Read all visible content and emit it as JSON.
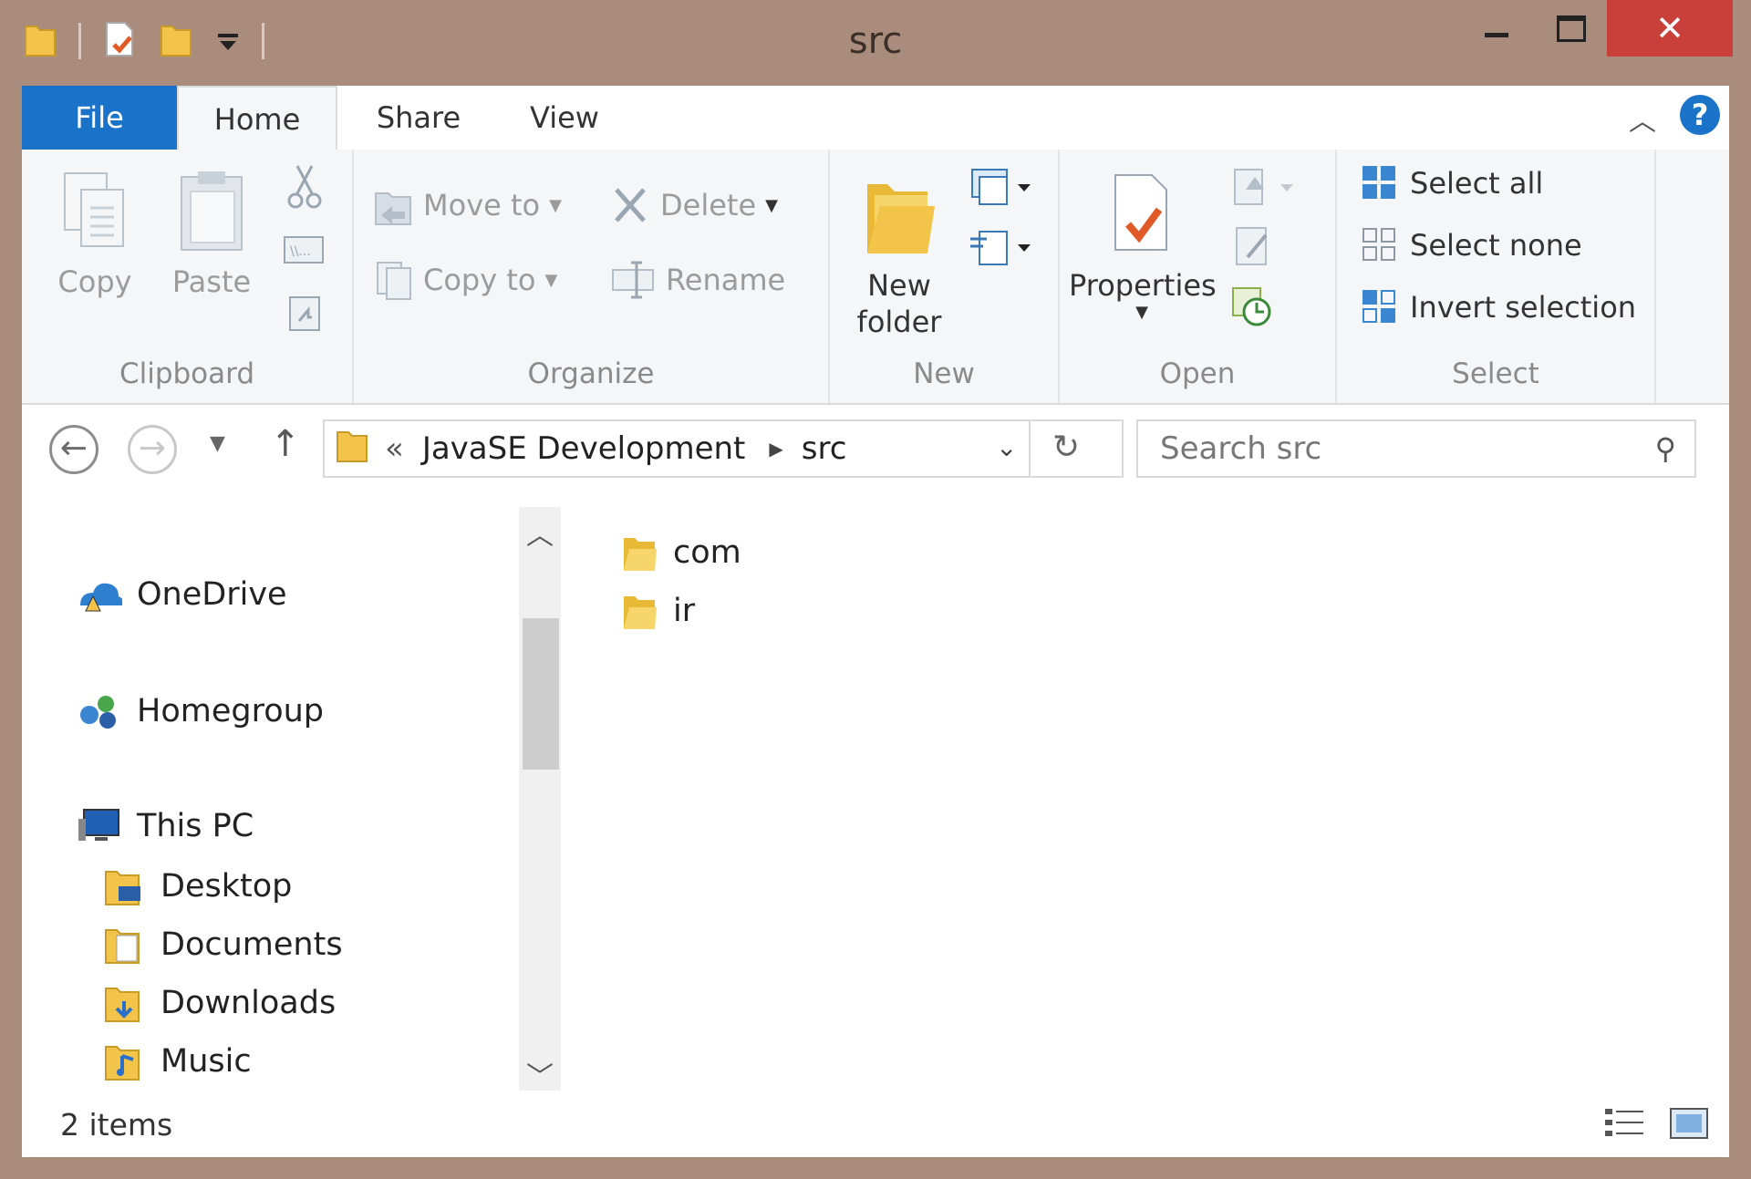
{
  "window": {
    "title": "src"
  },
  "titlebar": {
    "minimize_label": "",
    "maximize_label": "",
    "close_label": "✕"
  },
  "tabs": [
    {
      "label": "File"
    },
    {
      "label": "Home"
    },
    {
      "label": "Share"
    },
    {
      "label": "View"
    }
  ],
  "ribbon": {
    "clipboard": {
      "group_label": "Clipboard",
      "copy": "Copy",
      "paste": "Paste"
    },
    "organize": {
      "group_label": "Organize",
      "move_to": "Move to",
      "copy_to": "Copy to",
      "delete": "Delete",
      "rename": "Rename"
    },
    "new": {
      "group_label": "New",
      "new_folder_line1": "New",
      "new_folder_line2": "folder"
    },
    "open": {
      "group_label": "Open",
      "properties": "Properties"
    },
    "select": {
      "group_label": "Select",
      "select_all": "Select all",
      "select_none": "Select none",
      "invert": "Invert selection"
    }
  },
  "address": {
    "overflow": "«",
    "crumb1": "JavaSE Development",
    "crumb2": "src",
    "search_placeholder": "Search src"
  },
  "navpane": {
    "onedrive": "OneDrive",
    "homegroup": "Homegroup",
    "thispc": "This PC",
    "desktop": "Desktop",
    "documents": "Documents",
    "downloads": "Downloads",
    "music": "Music"
  },
  "files": [
    {
      "name": "com"
    },
    {
      "name": "ir"
    }
  ],
  "status": {
    "count": "2 items"
  },
  "colors": {
    "accent": "#1a73c9",
    "close": "#c9403a",
    "folder": "#f2c54a"
  }
}
